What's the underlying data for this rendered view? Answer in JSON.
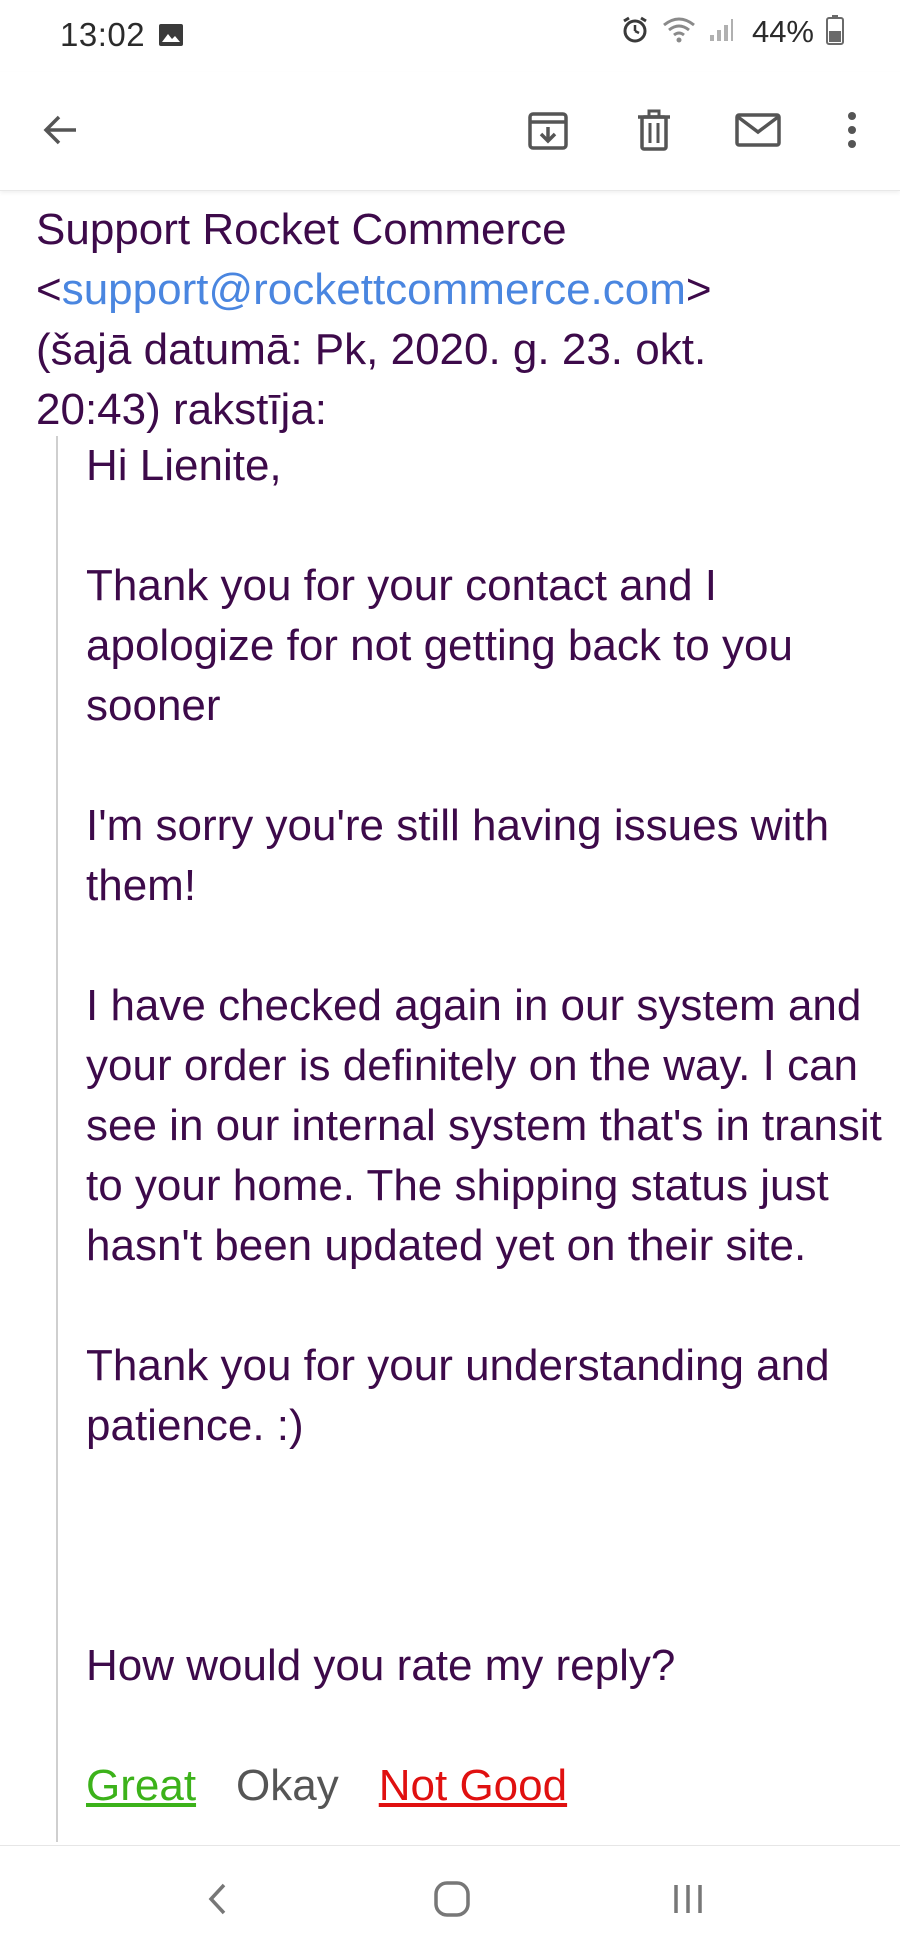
{
  "status_bar": {
    "time": "13:02",
    "battery_percent": "44%",
    "icons": [
      "gallery-icon",
      "alarm-icon",
      "wifi-icon",
      "signal-icon",
      "battery-icon"
    ]
  },
  "app_bar": {
    "icons": [
      "back-arrow-icon",
      "archive-icon",
      "delete-icon",
      "mark-unread-icon",
      "more-vert-icon"
    ]
  },
  "email": {
    "sender_name": "Support Rocket Commerce",
    "sender_email": "support@rockettcommerce.com",
    "date_line_1": "(šajā datumā: Pk, 2020. g. 23. okt.",
    "date_line_2": "20:43) rakstīja:",
    "greeting": "Hi Lienite,",
    "para1": "Thank you for your contact and I apologize for not getting back to you sooner",
    "para2": "I'm sorry you're still having issues with them!",
    "para3": "I have checked again in our system and your order is definitely on the way. I can see in our internal system that's in transit to your home. The shipping status just hasn't been updated yet on their site.",
    "para4": "Thank you for your understanding and patience. :)",
    "rating_question": "How would you rate my reply?",
    "rating_great": "Great",
    "rating_okay": "Okay",
    "rating_not_good": "Not Good"
  },
  "colors": {
    "text": "#3d0a4a",
    "link": "#4a86e0",
    "great": "#3cb21a",
    "not_good": "#e01010"
  },
  "nav_bar": {
    "icons": [
      "nav-back-icon",
      "nav-home-icon",
      "nav-recents-icon"
    ]
  }
}
